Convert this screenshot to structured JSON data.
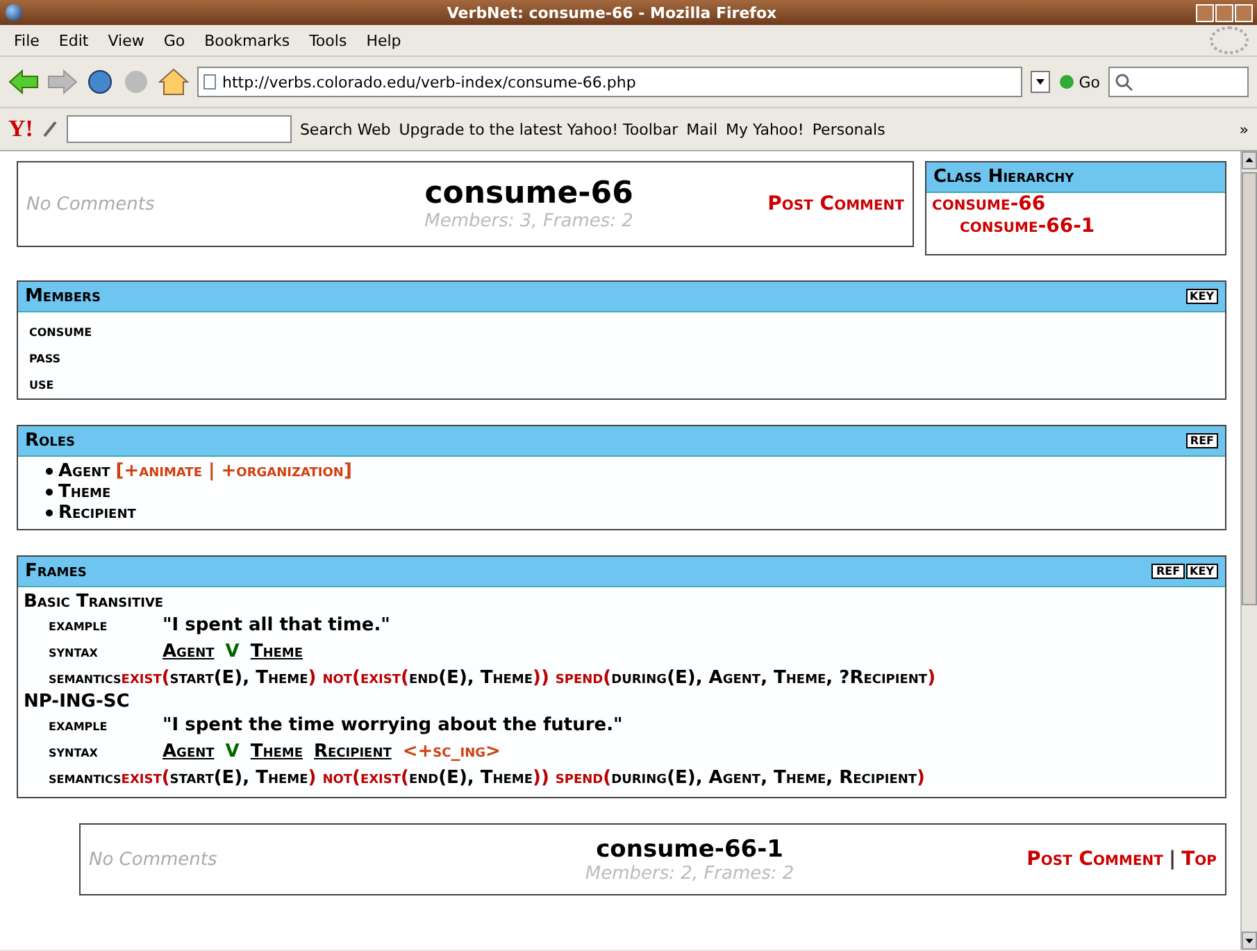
{
  "window": {
    "title": "VerbNet: consume-66 - Mozilla Firefox"
  },
  "menu": [
    "File",
    "Edit",
    "View",
    "Go",
    "Bookmarks",
    "Tools",
    "Help"
  ],
  "address": {
    "value": "http://verbs.colorado.edu/verb-index/consume-66.php"
  },
  "go_button": "Go",
  "yahoo_toolbar": {
    "logo": "Y!",
    "items": [
      "Search Web",
      "Upgrade to the latest Yahoo! Toolbar",
      "Mail",
      "My Yahoo!",
      "Personals"
    ],
    "more": "»"
  },
  "class_header": {
    "comments": "No Comments",
    "title": "consume-66",
    "counts": "Members: 3, Frames: 2",
    "links": [
      "Post Comment"
    ]
  },
  "class_hierarchy": {
    "title": "Class Hierarchy",
    "children": [
      {
        "label": "consume-66",
        "children": [
          {
            "label": "consume-66-1"
          }
        ]
      }
    ]
  },
  "members": {
    "title": "Members",
    "buttons": [
      "KEY"
    ],
    "items": [
      "consume",
      "pass",
      "use"
    ]
  },
  "roles": {
    "title": "Roles",
    "buttons": [
      "REF"
    ],
    "items": [
      {
        "name": "Agent",
        "restrictions": "[+animate | +organization]"
      },
      {
        "name": "Theme"
      },
      {
        "name": "Recipient"
      }
    ]
  },
  "frames": {
    "title": "Frames",
    "buttons": [
      "REF",
      "KEY"
    ],
    "items": [
      {
        "name": "Basic Transitive",
        "labels": {
          "example": "example",
          "syntax": "syntax",
          "semantics": "semantics"
        },
        "example": "\"I spent all that time.\"",
        "syntax": [
          {
            "kind": "role",
            "text": "Agent"
          },
          {
            "kind": "verb",
            "text": "V"
          },
          {
            "kind": "role",
            "text": "Theme"
          }
        ],
        "semantics": [
          {
            "kind": "predicate",
            "text": "exist("
          },
          {
            "kind": "argument",
            "text": "start(E), Theme"
          },
          {
            "kind": "predicate",
            "text": ") not(exist("
          },
          {
            "kind": "argument",
            "text": "end(E), Theme"
          },
          {
            "kind": "predicate",
            "text": ")) spend("
          },
          {
            "kind": "argument",
            "text": "during(E), Agent, Theme, ?Recipient"
          },
          {
            "kind": "predicate",
            "text": ")"
          }
        ]
      },
      {
        "name": "NP-ING-SC",
        "labels": {
          "example": "example",
          "syntax": "syntax",
          "semantics": "semantics"
        },
        "example": "\"I spent the time worrying about the future.\"",
        "syntax": [
          {
            "kind": "role",
            "text": "Agent"
          },
          {
            "kind": "verb",
            "text": "V"
          },
          {
            "kind": "role",
            "text": "Theme"
          },
          {
            "kind": "role",
            "text": "Recipient"
          },
          {
            "kind": "restriction",
            "text": "<+sc_ing>"
          }
        ],
        "semantics": [
          {
            "kind": "predicate",
            "text": "exist("
          },
          {
            "kind": "argument",
            "text": "start(E), Theme"
          },
          {
            "kind": "predicate",
            "text": ") not(exist("
          },
          {
            "kind": "argument",
            "text": "end(E), Theme"
          },
          {
            "kind": "predicate",
            "text": ")) spend("
          },
          {
            "kind": "argument",
            "text": "during(E), Agent, Theme, Recipient"
          },
          {
            "kind": "predicate",
            "text": ")"
          }
        ]
      }
    ]
  },
  "subclass_header": {
    "comments": "No Comments",
    "title": "consume-66-1",
    "counts": "Members: 2, Frames: 2",
    "links": [
      "Post Comment",
      "Top"
    ],
    "separator": "|"
  }
}
